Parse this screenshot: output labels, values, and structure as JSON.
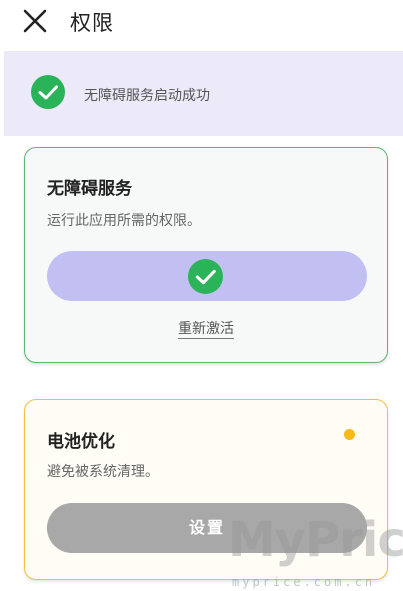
{
  "header": {
    "title": "权限",
    "close_icon": "close-icon"
  },
  "banner": {
    "text": "无障碍服务启动成功",
    "icon": "check-circle-icon",
    "background": "#eceaf9",
    "icon_color": "#2bb35a"
  },
  "accessibility_card": {
    "title": "无障碍服务",
    "description": "运行此应用所需的权限。",
    "button_icon": "check-circle-icon",
    "button_color": "#c2c0f2",
    "border_color": "#5cb571",
    "reactivate_label": "重新激活"
  },
  "battery_card": {
    "title": "电池优化",
    "description": "避免被系统清理。",
    "status_dot_color": "#f6ba15",
    "button_label": "设置",
    "button_color": "#a8a8a8",
    "border_color": "#f2c041"
  },
  "watermark": {
    "main": "MyPrice",
    "sub": "myprice.com.cn"
  }
}
